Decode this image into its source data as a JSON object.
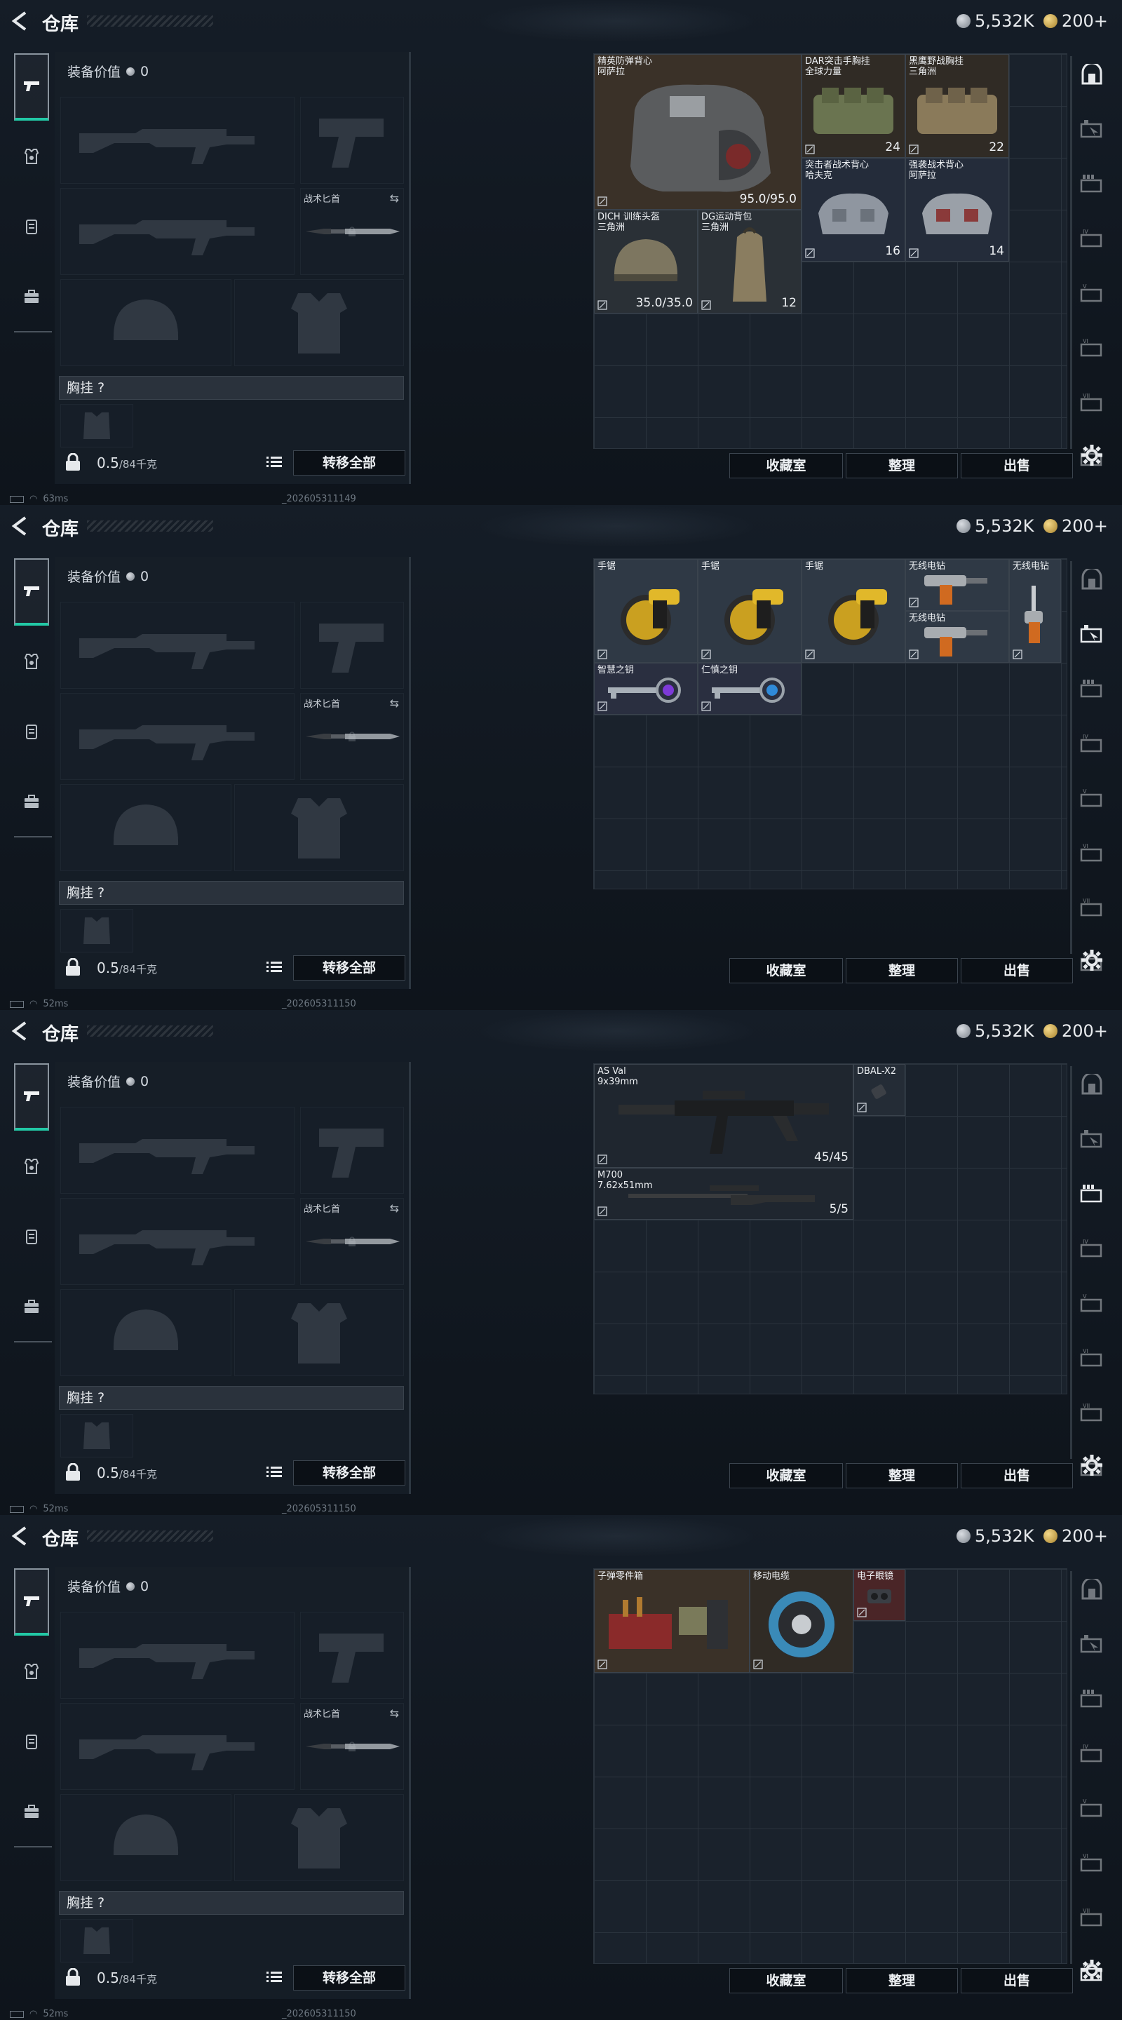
{
  "header": {
    "title": "仓库",
    "silver_amount": "5,532K",
    "gold_amount": "200+"
  },
  "equipment": {
    "value_label": "装备价值",
    "value": "0",
    "knife_label": "战术匕首",
    "chest_label": "胸挂 ?",
    "weight": "0.5",
    "weight_capacity": "/84千克",
    "transfer_all": "转移全部"
  },
  "buttons": {
    "collection": "收藏室",
    "organize": "整理",
    "sell": "出售"
  },
  "panels": [
    {
      "ping": "63ms",
      "stamp": "_202605311149",
      "active_tab": 0,
      "items": [
        {
          "name": "精英防弹背心\n阿萨拉",
          "count": "95.0/95.0",
          "bg": "#3a3128"
        },
        {
          "name": "DAR突击手胸挂\n全球力量",
          "count": "24",
          "bg": "#302b25"
        },
        {
          "name": "黑鹰野战胸挂\n三角洲",
          "count": "22",
          "bg": "#302b25"
        },
        {
          "name": "突击者战术背心\n哈夫克",
          "count": "16",
          "bg": "#242c3a"
        },
        {
          "name": "强袭战术背心\n阿萨拉",
          "count": "14",
          "bg": "#242c3a"
        },
        {
          "name": "DICH 训练头盔\n三角洲",
          "count": "35.0/35.0",
          "bg": "#2a3036"
        },
        {
          "name": "DG运动背包\n三角洲",
          "count": "12",
          "bg": "#2a3036"
        }
      ]
    },
    {
      "ping": "52ms",
      "stamp": "_202605311150",
      "active_tab": 1,
      "items": [
        {
          "name": "手锯",
          "count": "",
          "bg": "#2f3945"
        },
        {
          "name": "手锯",
          "count": "",
          "bg": "#2f3945"
        },
        {
          "name": "手锯",
          "count": "",
          "bg": "#2f3945"
        },
        {
          "name": "无线电钻",
          "count": "",
          "bg": "#2f3945"
        },
        {
          "name": "无线电钻",
          "count": "",
          "bg": "#2f3945"
        },
        {
          "name": "无线电钻",
          "count": "",
          "bg": "#2f3945"
        },
        {
          "name": "智慧之钥",
          "count": "",
          "bg": "#2a2f40"
        },
        {
          "name": "仁慎之钥",
          "count": "",
          "bg": "#2a2f40"
        }
      ]
    },
    {
      "ping": "52ms",
      "stamp": "_202605311150",
      "active_tab": 2,
      "items": [
        {
          "name": "AS Val\n9x39mm",
          "count": "45/45",
          "bg": "#1f262f"
        },
        {
          "name": "DBAL-X2",
          "count": "",
          "bg": "#242c36"
        },
        {
          "name": "M700\n7.62x51mm",
          "count": "5/5",
          "bg": "#1f262f"
        }
      ]
    },
    {
      "ping": "52ms",
      "stamp": "_202605311150",
      "active_tab": 7,
      "items": [
        {
          "name": "子弹零件箱",
          "count": "",
          "bg": "#3a3128"
        },
        {
          "name": "移动电缆",
          "count": "",
          "bg": "#302b25"
        },
        {
          "name": "电子眼镜",
          "count": "",
          "bg": "#4a2527"
        }
      ]
    }
  ]
}
